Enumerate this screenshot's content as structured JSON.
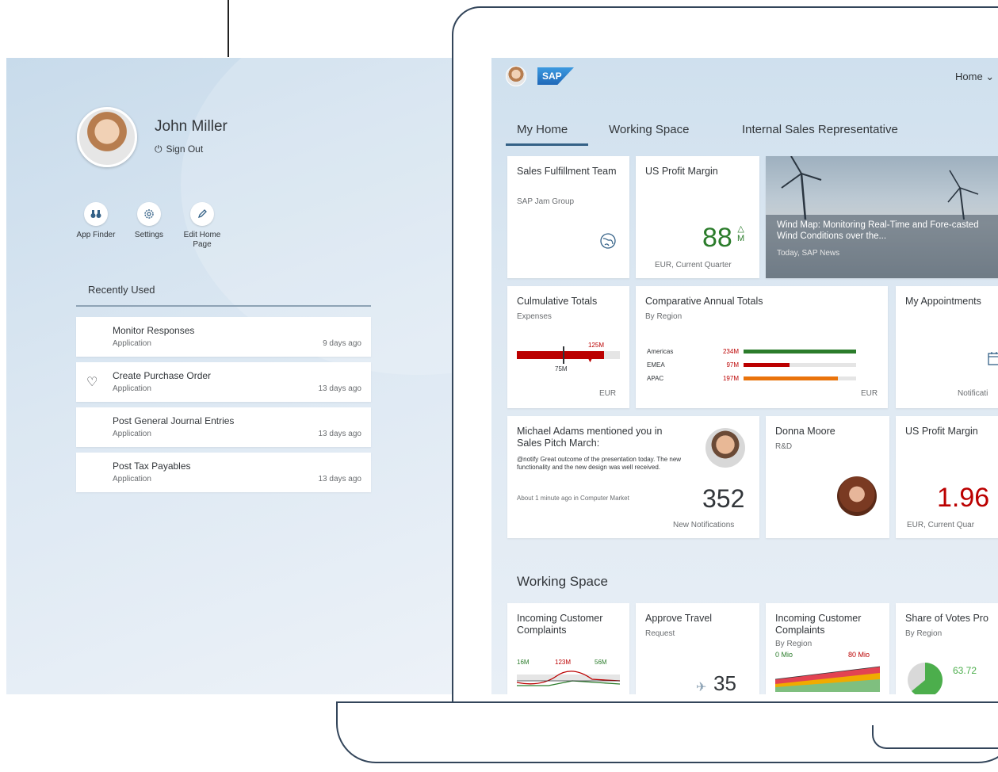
{
  "user_menu": {
    "name": "John Miller",
    "sign_out": "Sign Out",
    "actions": [
      {
        "icon": "binoculars-icon",
        "label": "App Finder"
      },
      {
        "icon": "gear-icon",
        "label": "Settings"
      },
      {
        "icon": "pencil-icon",
        "label": "Edit Home Page"
      }
    ],
    "recent_title": "Recently Used",
    "recent_items": [
      {
        "title": "Monitor Responses",
        "type": "Application",
        "time": "9 days ago",
        "favorite": false
      },
      {
        "title": "Create Purchase Order",
        "type": "Application",
        "time": "13 days ago",
        "favorite": true
      },
      {
        "title": "Post General Journal Entries",
        "type": "Application",
        "time": "13 days ago",
        "favorite": false
      },
      {
        "title": "Post Tax Payables",
        "type": "Application",
        "time": "13 days ago",
        "favorite": false
      }
    ]
  },
  "shell": {
    "logo": "SAP",
    "home_label": "Home ⌄"
  },
  "tabs": [
    "My Home",
    "Working Space",
    "Internal Sales Representative"
  ],
  "tiles": {
    "sales_team": {
      "title": "Sales Fulfillment Team",
      "subtitle": "SAP Jam Group"
    },
    "us_profit_1": {
      "title": "US Profit Margin",
      "value": "88",
      "unit": "M",
      "arrow": "△",
      "footer": "EUR, Current Quarter"
    },
    "news": {
      "text": "Wind Map: Monitoring Real-Time and Fore-casted Wind Conditions over the...",
      "footer": "Today, SAP News"
    },
    "cumulative": {
      "title": "Culmulative Totals",
      "subtitle": "Expenses",
      "target": "125M",
      "actual": "75M",
      "currency": "EUR"
    },
    "comparative": {
      "title": "Comparative Annual Totals",
      "subtitle": "By Region",
      "currency": "EUR",
      "rows": [
        {
          "label": "Americas",
          "value": "234M",
          "fraction": 1.0,
          "color": "#2b7c2b"
        },
        {
          "label": "EMEA",
          "value": "97M",
          "fraction": 0.41,
          "color": "#bb0000"
        },
        {
          "label": "APAC",
          "value": "197M",
          "fraction": 0.84,
          "color": "#e9730c"
        }
      ]
    },
    "appointments": {
      "title": "My Appointments",
      "footer": "Notificati"
    },
    "mention": {
      "title": "Michael Adams mentioned you in Sales Pitch March:",
      "body": "@notify Great outcome of the presentation today. The new functionality and the new design was well received.",
      "meta": "About 1 minute ago in Computer Market",
      "count": "352",
      "count_label": "New Notifications"
    },
    "donna": {
      "title": "Donna Moore",
      "subtitle": "R&D"
    },
    "us_profit_2": {
      "title": "US Profit Margin",
      "value": "1.96",
      "footer": "EUR, Current Quar"
    },
    "working_space_title": "Working Space",
    "complaints_1": {
      "title": "Incoming Customer Complaints",
      "v1": "16M",
      "v2": "123M",
      "v3": "56M"
    },
    "travel": {
      "title": "Approve Travel",
      "subtitle": "Request",
      "value": "35"
    },
    "complaints_2": {
      "title": "Incoming Customer Complaints",
      "subtitle": "By Region",
      "min": "0 Mio",
      "max": "80 Mio"
    },
    "votes": {
      "title": "Share of Votes Pro",
      "subtitle": "By Region",
      "value": "63.72",
      "share": 0.64
    }
  }
}
